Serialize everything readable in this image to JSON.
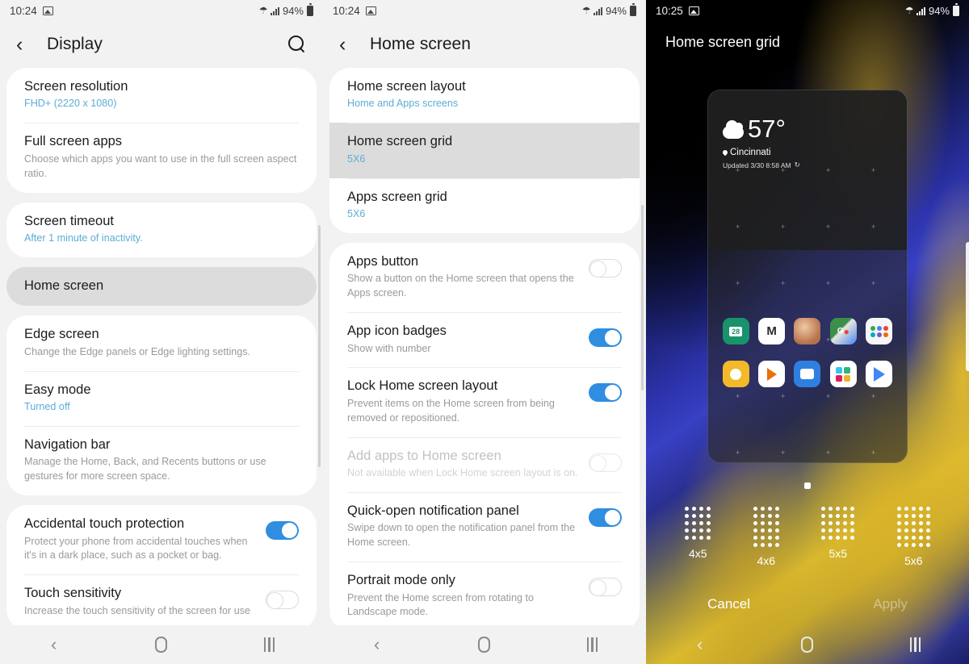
{
  "panel1": {
    "status": {
      "time": "10:24",
      "battery": "94%",
      "photo_icon": "image-icon",
      "wifi_icon": "wifi-icon",
      "signal_icon": "signal-icon",
      "battery_icon": "battery-icon"
    },
    "header": {
      "title": "Display",
      "back_icon": "back-chevron-icon",
      "search_icon": "search-icon"
    },
    "groups": [
      {
        "rows": [
          {
            "title": "Screen resolution",
            "sub": "FHD+ (2220 x 1080)",
            "sub_accent": true
          },
          {
            "title": "Full screen apps",
            "sub": "Choose which apps you want to use in the full screen aspect ratio.",
            "sub_accent": false
          }
        ]
      },
      {
        "rows": [
          {
            "title": "Screen timeout",
            "sub": "After 1 minute of inactivity.",
            "sub_accent": true
          }
        ]
      },
      {
        "selected": true,
        "rows": [
          {
            "title": "Home screen",
            "sub": "",
            "sub_accent": false
          }
        ]
      },
      {
        "rows": [
          {
            "title": "Edge screen",
            "sub": "Change the Edge panels or Edge lighting settings.",
            "sub_accent": false
          },
          {
            "title": "Easy mode",
            "sub": "Turned off",
            "sub_accent": true
          },
          {
            "title": "Navigation bar",
            "sub": "Manage the Home, Back, and Recents buttons or use gestures for more screen space.",
            "sub_accent": false
          }
        ]
      },
      {
        "rows": [
          {
            "title": "Accidental touch protection",
            "sub": "Protect your phone from accidental touches when it's in a dark place, such as a pocket or bag.",
            "sub_accent": false,
            "toggle": "on"
          },
          {
            "title": "Touch sensitivity",
            "sub": "Increase the touch sensitivity of the screen for use",
            "sub_accent": false,
            "toggle": "off"
          }
        ]
      }
    ],
    "navbar": {
      "back": "back-icon",
      "home": "home-icon",
      "recents": "recents-icon"
    }
  },
  "panel2": {
    "status": {
      "time": "10:24",
      "battery": "94%"
    },
    "header": {
      "title": "Home screen",
      "back_icon": "back-chevron-icon"
    },
    "groups": [
      {
        "rows": [
          {
            "title": "Home screen layout",
            "sub": "Home and Apps screens",
            "sub_accent": true
          },
          {
            "title": "Home screen grid",
            "sub": "5X6",
            "sub_accent": true,
            "selected": true
          },
          {
            "title": "Apps screen grid",
            "sub": "5X6",
            "sub_accent": true
          }
        ]
      },
      {
        "rows": [
          {
            "title": "Apps button",
            "sub": "Show a button on the Home screen that opens the Apps screen.",
            "sub_accent": false,
            "toggle": "off"
          },
          {
            "title": "App icon badges",
            "sub": "Show with number",
            "sub_accent": false,
            "toggle": "on"
          },
          {
            "title": "Lock Home screen layout",
            "sub": "Prevent items on the Home screen from being removed or repositioned.",
            "sub_accent": false,
            "toggle": "on"
          },
          {
            "title": "Add apps to Home screen",
            "sub": "Not available when Lock Home screen layout is on.",
            "sub_accent": false,
            "toggle": "off",
            "disabled": true
          },
          {
            "title": "Quick-open notification panel",
            "sub": "Swipe down to open the notification panel from the Home screen.",
            "sub_accent": false,
            "toggle": "on"
          },
          {
            "title": "Portrait mode only",
            "sub": "Prevent the Home screen from rotating to Landscape mode.",
            "sub_accent": false,
            "toggle": "off"
          }
        ]
      }
    ]
  },
  "panel3": {
    "status": {
      "time": "10:25",
      "battery": "94%"
    },
    "title": "Home screen grid",
    "weather": {
      "temp": "57°",
      "location": "Cincinnati",
      "updated": "Updated 3/30 8:58 AM",
      "cloud_icon": "cloud-icon",
      "refresh_icon": "refresh-icon",
      "pin_icon": "location-pin-icon"
    },
    "apps_row1": [
      {
        "name": "calendar-app-icon",
        "label": "28"
      },
      {
        "name": "mail-app-icon",
        "label": "M"
      },
      {
        "name": "contact-photo-icon",
        "label": ""
      },
      {
        "name": "maps-app-icon",
        "label": "G"
      },
      {
        "name": "app-folder-icon",
        "label": ""
      }
    ],
    "apps_row2": [
      {
        "name": "bulb-app-icon",
        "label": ""
      },
      {
        "name": "play-music-app-icon",
        "label": ""
      },
      {
        "name": "messages-app-icon",
        "label": ""
      },
      {
        "name": "slack-app-icon",
        "label": ""
      },
      {
        "name": "play-store-app-icon",
        "label": ""
      }
    ],
    "grid_choices": [
      {
        "label": "4x5",
        "cols": 4,
        "rows": 5
      },
      {
        "label": "4x6",
        "cols": 4,
        "rows": 6
      },
      {
        "label": "5x5",
        "cols": 5,
        "rows": 5
      },
      {
        "label": "5x6",
        "cols": 5,
        "rows": 6
      }
    ],
    "actions": {
      "cancel": "Cancel",
      "apply": "Apply",
      "apply_disabled": true
    }
  },
  "colors": {
    "accent_blue": "#5badd6",
    "toggle_on": "#2f8ee0",
    "selected_row": "#dcdcdc"
  }
}
